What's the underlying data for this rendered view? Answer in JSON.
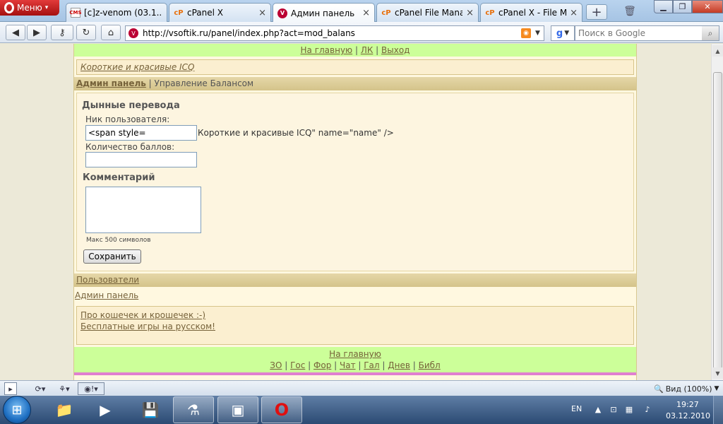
{
  "browser": {
    "menu_label": "Меню",
    "tabs": [
      {
        "label": "[c]z-venom (03.1...",
        "favicon": "CMS"
      },
      {
        "label": "cPanel X",
        "favicon": "cP"
      },
      {
        "label": "Админ панель",
        "favicon": "V"
      },
      {
        "label": "cPanel File Mana...",
        "favicon": "cP"
      },
      {
        "label": "cPanel X - File M...",
        "favicon": "cP"
      }
    ],
    "active_tab": 2,
    "url": "http://vsoftik.ru/panel/index.php?act=mod_balans",
    "search_placeholder": "Поиск в Google",
    "search_engine": "g",
    "zoom_label": "Вид (100%)",
    "accent": "#cc1a1a"
  },
  "page": {
    "topnav": {
      "home": "На главную",
      "sep": " | ",
      "lk": "ЛК",
      "exit": "Выход"
    },
    "banner": "Короткие и красивые ICQ",
    "crumb": {
      "root": "Админ панель",
      "sep": " | ",
      "current": "Управление Балансом"
    },
    "form": {
      "heading": "Дынные перевода",
      "nick_label": "Ник пользователя:",
      "nick_value": "<span style=",
      "nick_spill": "Короткие и красивые ICQ\" name=\"name\" />",
      "amount_label": "Количество баллов:",
      "amount_value": "",
      "comment_heading": "Комментарий",
      "comment_value": "",
      "maxlen": "Макс 500 символов",
      "save": "Сохранить"
    },
    "users_link": "Пользователи",
    "admin_link": "Админ панель",
    "links": [
      "Про кошечек и крошечек :-)",
      "Бесплатные игры на русском!"
    ],
    "footer": {
      "home": "На главную",
      "items": [
        "ЗО",
        "Гос",
        "Фор",
        "Чат",
        "Гал",
        "Днев",
        "Библ"
      ],
      "sep": " | "
    }
  },
  "taskbar": {
    "lang": "EN",
    "time": "19:27",
    "date": "03.12.2010"
  }
}
